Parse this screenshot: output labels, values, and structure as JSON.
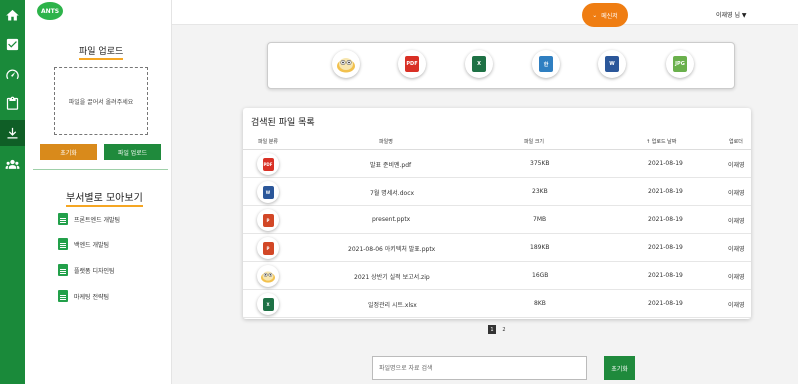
{
  "brand": {
    "logo_text": "ANTS",
    "color": "#1a8a3a"
  },
  "rail": {
    "items": [
      {
        "icon": "home-icon"
      },
      {
        "icon": "checklist-icon"
      },
      {
        "icon": "dashboard-icon"
      },
      {
        "icon": "clipboard-icon"
      },
      {
        "icon": "download-icon",
        "active": true
      },
      {
        "icon": "users-icon"
      }
    ]
  },
  "header": {
    "message_label": "메신저",
    "user_label": "이재영 님 ▼"
  },
  "upload": {
    "title": "파일 업로드",
    "dropzone_text": "파일을 끌어서 올려주세요",
    "reset_label": "초기화",
    "upload_label": "파일 업로드"
  },
  "departments": {
    "title": "부서별로 모아보기",
    "items": [
      {
        "label": "프론트엔드 개발팀"
      },
      {
        "label": "백엔드 개발팀"
      },
      {
        "label": "플랫폼 디자인팀"
      },
      {
        "label": "마케팅 전략팀"
      }
    ]
  },
  "file_types": [
    {
      "name": "hwp",
      "label": ""
    },
    {
      "name": "pdf",
      "label": "PDF"
    },
    {
      "name": "excel",
      "label": "X"
    },
    {
      "name": "hangul",
      "label": "한"
    },
    {
      "name": "word",
      "label": "W"
    },
    {
      "name": "jpg",
      "label": "JPG"
    }
  ],
  "file_list": {
    "title": "검색된 파일 목록",
    "columns": {
      "type": "파일 분류",
      "name": "파일명",
      "size": "파일 크기",
      "date": "↑ 업로드 날짜",
      "uploader": "업로더"
    },
    "rows": [
      {
        "type": "pdf",
        "type_label": "PDF",
        "name": "발표 준비멘.pdf",
        "size": "375KB",
        "date": "2021-08-19",
        "uploader": "이재영"
      },
      {
        "type": "word",
        "type_label": "W",
        "name": "7월 명세서.docx",
        "size": "23KB",
        "date": "2021-08-19",
        "uploader": "이재영"
      },
      {
        "type": "ppt",
        "type_label": "P",
        "name": "present.pptx",
        "size": "7MB",
        "date": "2021-08-19",
        "uploader": "이재영"
      },
      {
        "type": "ppt",
        "type_label": "P",
        "name": "2021-08-06 아키텍처 발표.pptx",
        "size": "189KB",
        "date": "2021-08-19",
        "uploader": "이재영"
      },
      {
        "type": "zip",
        "type_label": "",
        "name": "2021 상반기 실적 보고서.zip",
        "size": "16GB",
        "date": "2021-08-19",
        "uploader": "이재영"
      },
      {
        "type": "excel",
        "type_label": "X",
        "name": "일정관리 시트.xlsx",
        "size": "8KB",
        "date": "2021-08-19",
        "uploader": "이재영"
      }
    ]
  },
  "pagination": {
    "pages": [
      "1",
      "2"
    ],
    "current": "1"
  },
  "search": {
    "placeholder": "파일명으로 자료 검색",
    "reset_label": "초기화"
  },
  "colors": {
    "accent_green": "#1f8a3c",
    "accent_orange": "#ef7d12",
    "reset_orange": "#d98a1b",
    "pdf": "#d93025",
    "word": "#2b579a",
    "excel": "#1e7145",
    "ppt": "#d24726",
    "hangul": "#2f7fc1",
    "jpg": "#6ab04c"
  }
}
